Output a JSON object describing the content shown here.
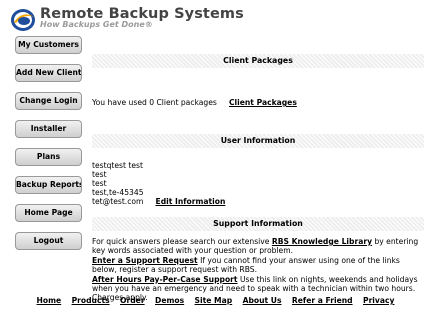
{
  "header": {
    "title": "Remote Backup Systems",
    "tagline": "How Backups Get Done®"
  },
  "sidebar": {
    "items": [
      {
        "label": "My Customers"
      },
      {
        "label": "Add New Client"
      },
      {
        "label": "Change Login"
      },
      {
        "label": "Installer"
      },
      {
        "label": "Plans"
      },
      {
        "label": "Backup Reports"
      },
      {
        "label": "Home Page"
      },
      {
        "label": "Logout"
      }
    ]
  },
  "client_packages": {
    "heading": "Client Packages",
    "usage_text": "You have used 0 Client packages",
    "link": "Client Packages"
  },
  "user_information": {
    "heading": "User Information",
    "name": "testqtest test",
    "line2": "test",
    "line3": "test",
    "location": "test,te-45345",
    "email": "tet@test.com",
    "edit_link": "Edit Information"
  },
  "support_information": {
    "heading": "Support Information",
    "kb_prefix": "For quick answers please search our extensive",
    "kb_link": "RBS Knowledge Library",
    "kb_suffix": "by entering key words associated with your question or problem.",
    "support_link": "Enter a Support Request",
    "support_text": "If you cannot find your answer using one of the links below, register a support request with RBS.",
    "after_hours_link": "After Hours Pay-Per-Case Support",
    "after_hours_text": "Use this link on nights, weekends and holidays when you have an emergency and need to speak with a technician within two hours. Charges apply."
  },
  "footer": {
    "links": [
      {
        "label": "Home"
      },
      {
        "label": "Products"
      },
      {
        "label": "Order"
      },
      {
        "label": "Demos"
      },
      {
        "label": "Site Map"
      },
      {
        "label": "About Us"
      },
      {
        "label": "Refer a Friend"
      },
      {
        "label": "Privacy"
      }
    ]
  },
  "colors": {
    "logo_blue": "#1f4e9c",
    "logo_orange": "#f2a400",
    "title_gray": "#444444"
  }
}
